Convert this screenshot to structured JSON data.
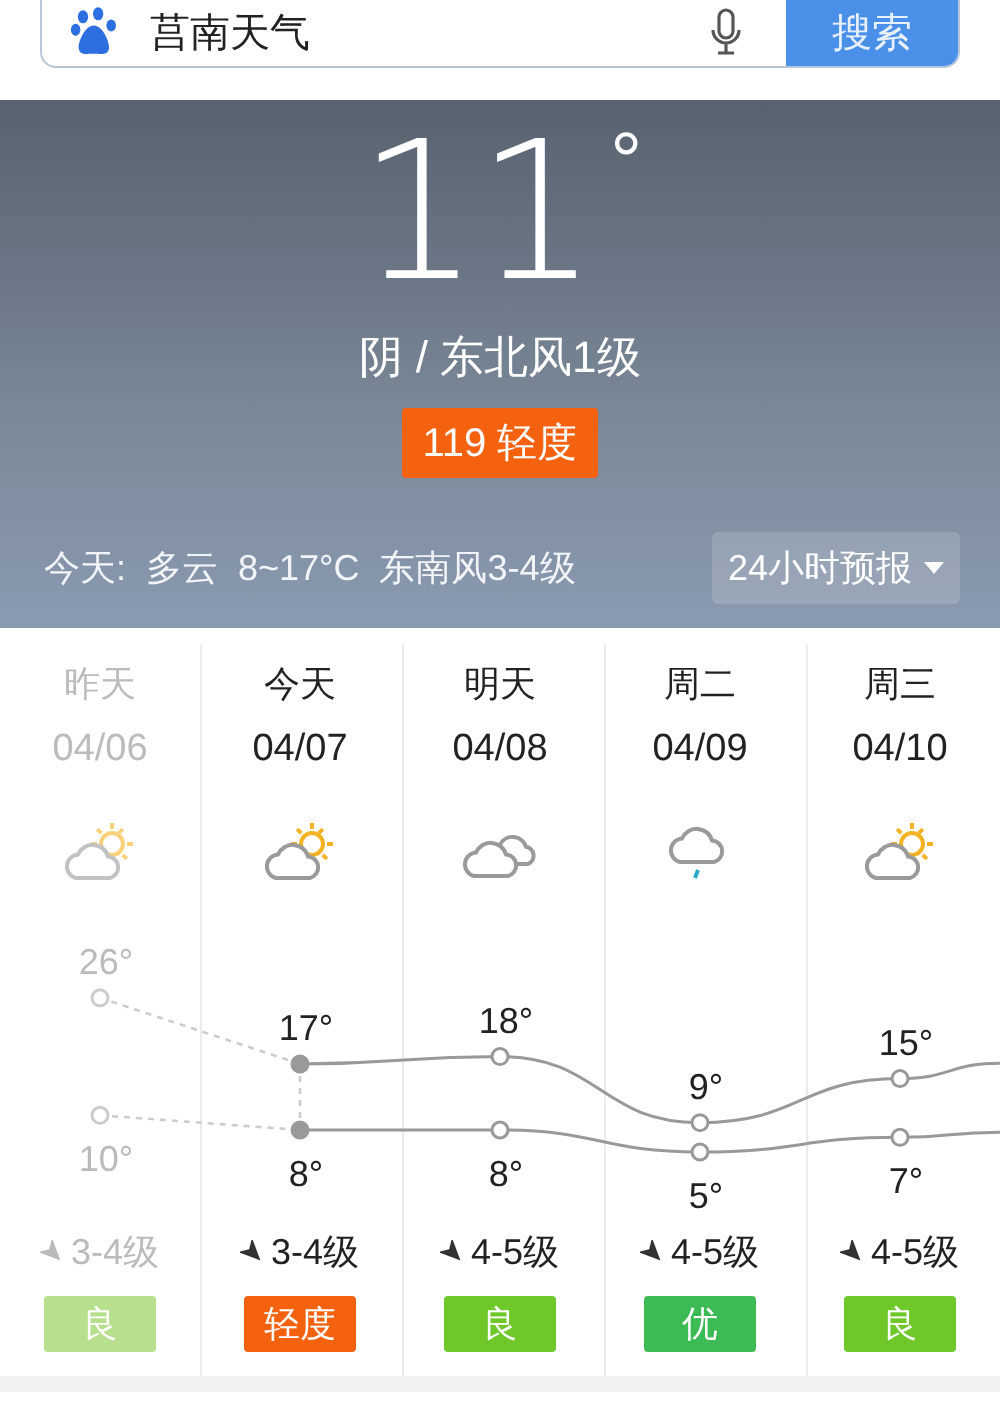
{
  "search": {
    "value": "莒南天气",
    "button": "搜索"
  },
  "current": {
    "temperature": "11",
    "degree": "°",
    "condition": "阴 / 东北风1级",
    "aqi": "119 轻度",
    "color": "#f5620f",
    "today_summary": "今天:  多云  8~17°C  东南风3-4级",
    "forecast_button": "24小时预报"
  },
  "days": [
    {
      "day": "昨天",
      "date": "04/06",
      "kind": "partly-cloudy",
      "past": true,
      "high": "26°",
      "low": "10°",
      "wind": "3-4级",
      "aqi": "良",
      "color": "#b7df8e"
    },
    {
      "day": "今天",
      "date": "04/07",
      "kind": "partly-cloudy",
      "past": false,
      "high": "17°",
      "low": "8°",
      "wind": "3-4级",
      "aqi": "轻度",
      "color": "#f5620f"
    },
    {
      "day": "明天",
      "date": "04/08",
      "kind": "cloudy",
      "past": false,
      "high": "18°",
      "low": "8°",
      "wind": "4-5级",
      "aqi": "良",
      "color": "#6fc72a"
    },
    {
      "day": "周二",
      "date": "04/09",
      "kind": "rain",
      "past": false,
      "high": "9°",
      "low": "5°",
      "wind": "4-5级",
      "aqi": "优",
      "color": "#3cba54"
    },
    {
      "day": "周三",
      "date": "04/10",
      "kind": "partly-cloudy",
      "past": false,
      "high": "15°",
      "low": "7°",
      "wind": "4-5级",
      "aqi": "良",
      "color": "#6fc72a"
    }
  ]
}
